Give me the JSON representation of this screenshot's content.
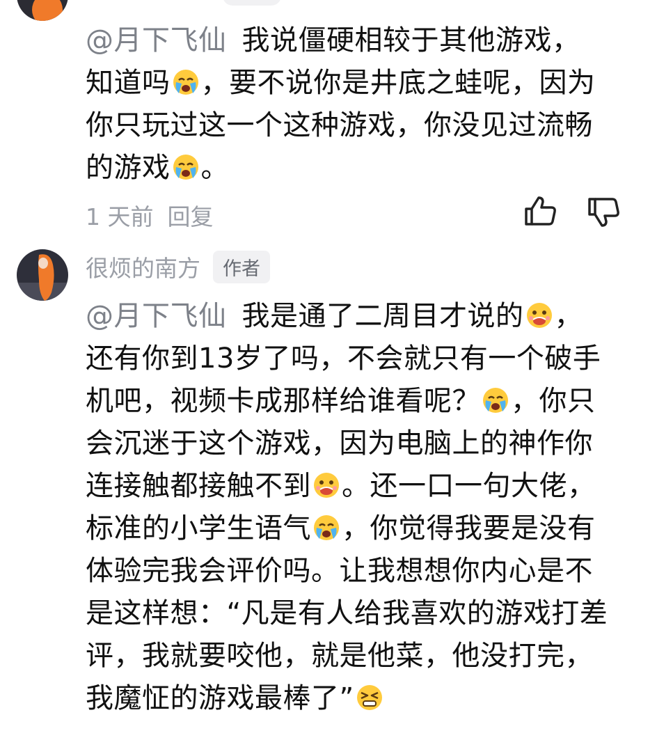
{
  "comment_1": {
    "mention": "@月下飞仙",
    "lines": [
      "我说僵硬相较于其他游戏，",
      "知道吗",
      "，要不说你是井底之蛙呢，因为",
      "你只玩过这一个这种游戏，你没见过流畅",
      "的游戏",
      "。"
    ],
    "time": "1 天前",
    "reply_label": "回复"
  },
  "comment_2": {
    "author": "很烦的南方",
    "author_badge": "作者",
    "mention": "@月下飞仙",
    "segments": [
      "我是通了二周目才说的",
      "，",
      "还有你到13岁了吗，不会就只有一个破手",
      "机吧，视频卡成那样给谁看呢？",
      "，你只",
      "会沉迷于这个游戏，因为电脑上的神作你",
      "连接触都接触不到",
      "。还一口一句大佬，",
      "标准的小学生语气",
      "，你觉得我要是没有",
      "体验完我会评价吗。让我想想你内心是不",
      "是这样想：“凡是有人给我喜欢的游戏打差",
      "评，我就要咬他，就是他菜，他没打完，",
      "我魔怔的游戏最棒了”"
    ]
  },
  "icons": {
    "like": "thumbs-up-icon",
    "dislike": "thumbs-down-icon",
    "crying": "crying-face-emoji",
    "drooling": "drooling-face-emoji",
    "disdain": "squinting-face-emoji"
  },
  "colors": {
    "text": "#111111",
    "muted": "#9a9ea6",
    "mention": "#7d8189",
    "badge_bg": "#f1f1f3"
  }
}
